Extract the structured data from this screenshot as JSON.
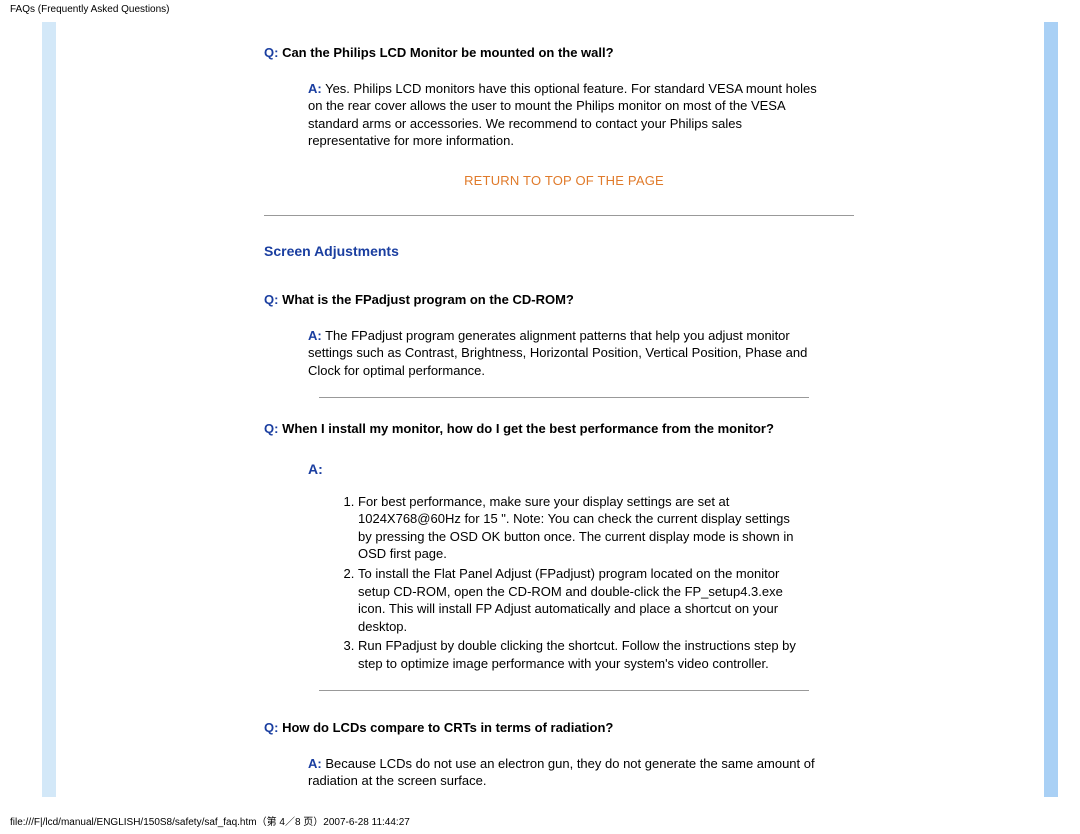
{
  "header": {
    "title": "FAQs (Frequently Asked Questions)"
  },
  "faq1": {
    "q_label": "Q:",
    "q_text": " Can the Philips LCD Monitor be mounted on the wall?",
    "a_label": "A:",
    "a_text": " Yes. Philips LCD monitors have this optional feature. For standard VESA mount holes on the rear cover allows the user to mount the Philips monitor on most of the VESA standard arms or accessories. We recommend to contact your Philips sales representative for more information."
  },
  "return_link": "RETURN TO TOP OF THE PAGE",
  "section2": {
    "title": "Screen Adjustments"
  },
  "faq2": {
    "q_label": "Q:",
    "q_text": " What is the FPadjust program on the CD-ROM?",
    "a_label": "A:",
    "a_text": " The FPadjust program generates alignment patterns that help you adjust monitor settings such as Contrast, Brightness, Horizontal Position, Vertical Position, Phase and Clock for optimal performance."
  },
  "faq3": {
    "q_label": "Q:",
    "q_text": " When I install my monitor, how do I get the best performance from the monitor?",
    "a_label": "A:",
    "steps": [
      "For best performance, make sure your display settings are set at 1024X768@60Hz for 15 \". Note: You can check the current display settings by pressing the OSD OK button once. The current display mode is shown in OSD first page.",
      "To install the Flat Panel Adjust (FPadjust) program located on the monitor setup CD-ROM, open the CD-ROM and double-click the FP_setup4.3.exe icon. This will install FP Adjust automatically and place a shortcut on your desktop.",
      "Run FPadjust by double clicking the shortcut. Follow the instructions step by step to optimize image performance with your system's video controller."
    ]
  },
  "faq4": {
    "q_label": "Q:",
    "q_text": " How do LCDs compare to CRTs in terms of radiation?",
    "a_label": "A:",
    "a_text": " Because LCDs do not use an electron gun, they do not generate the same amount of radiation at the screen surface."
  },
  "footer": {
    "text": "file:///F|/lcd/manual/ENGLISH/150S8/safety/saf_faq.htm（第 4／8 页）2007-6-28 11:44:27"
  }
}
